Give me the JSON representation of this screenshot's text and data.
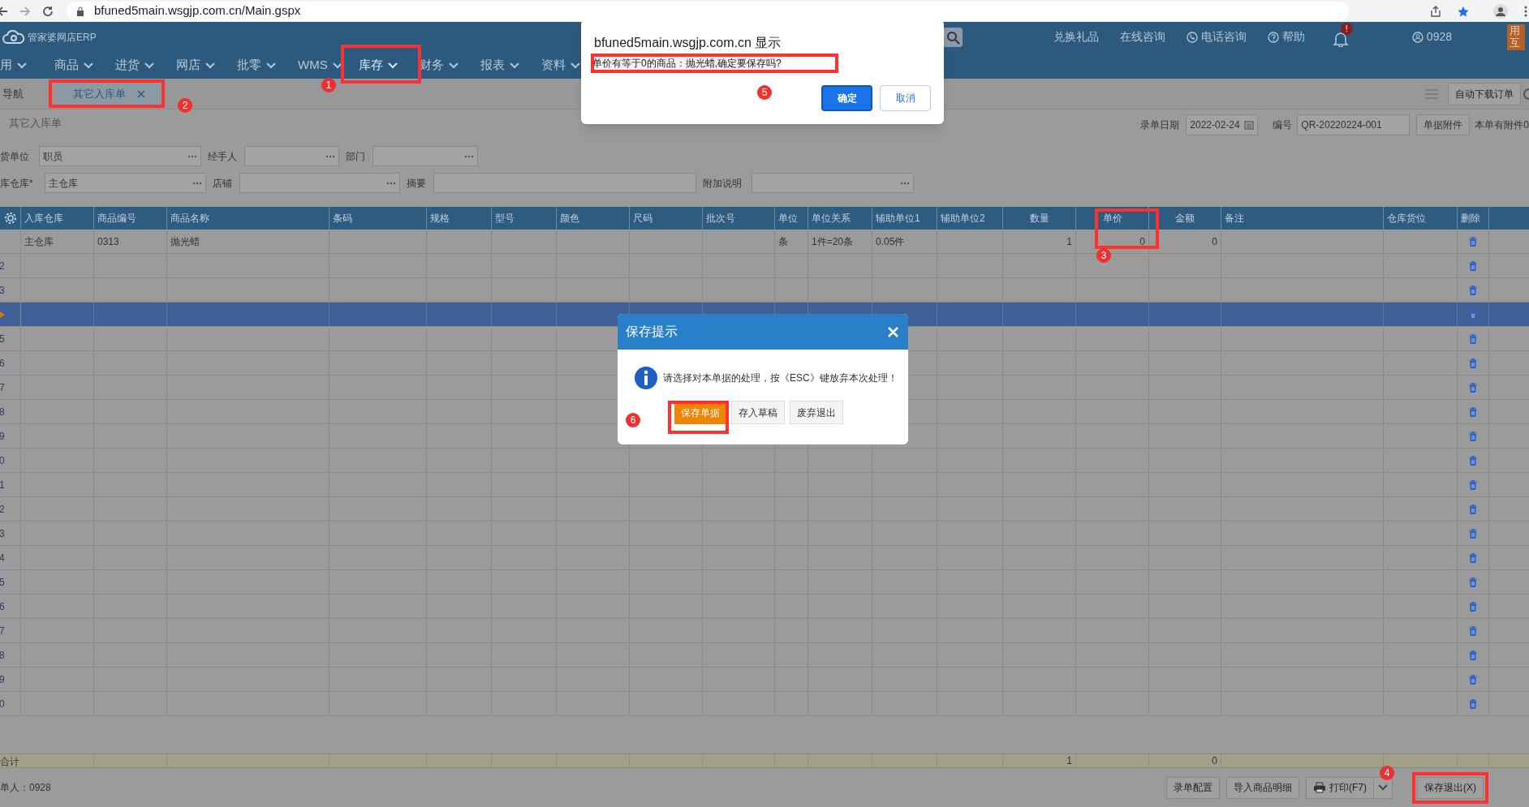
{
  "browser": {
    "url": "bfuned5main.wsgjp.com.cn/Main.gspx"
  },
  "header": {
    "logo": "管家婆网店ERP",
    "links": [
      {
        "kind": "plain",
        "label": "兑换礼品"
      },
      {
        "kind": "plain",
        "label": "在线咨询"
      },
      {
        "kind": "phone",
        "label": "电话咨询"
      },
      {
        "kind": "help",
        "label": "帮助"
      }
    ],
    "bell_badge": "!",
    "user": "0928",
    "promo": [
      "用",
      "互"
    ]
  },
  "menu": [
    {
      "label": "用",
      "selected": false
    },
    {
      "label": "商品",
      "selected": false
    },
    {
      "label": "进货",
      "selected": false
    },
    {
      "label": "网店",
      "selected": false
    },
    {
      "label": "批零",
      "selected": false
    },
    {
      "label": "WMS",
      "selected": false
    },
    {
      "label": "库存",
      "selected": true
    },
    {
      "label": "财务",
      "selected": false
    },
    {
      "label": "报表",
      "selected": false
    },
    {
      "label": "资料",
      "selected": false
    }
  ],
  "tabbar": {
    "nav": "导航",
    "tabs": [
      {
        "label": "其它入库单",
        "selected": true
      }
    ],
    "auto_download": "自动下载订单"
  },
  "form": {
    "title": "其它入库单",
    "date_label": "录单日期",
    "date": "2022-02-24",
    "number_label": "编号",
    "number": "QR-20220224-001",
    "attach_button": "单据附件",
    "attach_note": "本单有附件0",
    "row1": [
      {
        "label": "货单位",
        "value": "职员"
      },
      {
        "label": "经手人"
      },
      {
        "label": "部门"
      }
    ],
    "row2": [
      {
        "label": "库仓库*",
        "value": "主仓库"
      },
      {
        "label": "店铺"
      },
      {
        "label": "摘要",
        "kind": "text"
      },
      {
        "label": "附加说明"
      }
    ]
  },
  "table": {
    "columns": [
      {
        "kind": "text",
        "label": "入库仓库"
      },
      {
        "kind": "text",
        "label": "商品编号"
      },
      {
        "kind": "text",
        "label": "商品名称"
      },
      {
        "kind": "text",
        "label": "条码"
      },
      {
        "kind": "text",
        "label": "规格"
      },
      {
        "kind": "text",
        "label": "型号"
      },
      {
        "kind": "text",
        "label": "颜色"
      },
      {
        "kind": "text",
        "label": "尺码"
      },
      {
        "kind": "text",
        "label": "批次号"
      },
      {
        "kind": "text",
        "label": "单位"
      },
      {
        "kind": "text",
        "label": "单位关系"
      },
      {
        "kind": "text",
        "label": "辅助单位1"
      },
      {
        "kind": "text",
        "label": "辅助单位2"
      },
      {
        "kind": "number",
        "label": "数量"
      },
      {
        "kind": "number",
        "label": "单价"
      },
      {
        "kind": "number",
        "label": "金额"
      },
      {
        "kind": "text",
        "label": "备注"
      },
      {
        "kind": "text",
        "label": "仓库货位"
      },
      {
        "kind": "delete",
        "label": "删除"
      }
    ],
    "rows": [
      {
        "selected": false,
        "cells": [
          "主仓库",
          "0313",
          "抛光蜡",
          null,
          null,
          null,
          null,
          null,
          null,
          "条",
          "1件=20条",
          "0.05件",
          null,
          "1",
          "0",
          "0",
          null,
          null,
          null
        ]
      },
      {
        "label": "2",
        "selected": false
      },
      {
        "label": "3",
        "selected": false
      },
      {
        "selected": true
      },
      {
        "label": "5",
        "selected": false
      },
      {
        "label": "6",
        "selected": false
      },
      {
        "label": "7",
        "selected": false
      },
      {
        "label": "8",
        "selected": false
      },
      {
        "label": "9",
        "selected": false
      },
      {
        "label": "0",
        "selected": false
      },
      {
        "label": "1",
        "selected": false
      },
      {
        "label": "2",
        "selected": false
      },
      {
        "label": "3",
        "selected": false
      },
      {
        "label": "4",
        "selected": false
      },
      {
        "label": "5",
        "selected": false
      },
      {
        "label": "6",
        "selected": false
      },
      {
        "label": "7",
        "selected": false
      },
      {
        "label": "8",
        "selected": false
      },
      {
        "label": "9",
        "selected": false
      },
      {
        "label": "0",
        "selected": false
      }
    ],
    "total": {
      "label": "合计",
      "cells": [
        null,
        null,
        null,
        null,
        null,
        null,
        null,
        null,
        null,
        null,
        null,
        null,
        null,
        "1",
        null,
        "0",
        null,
        null,
        null
      ]
    }
  },
  "footer": {
    "maker": "单人：0928",
    "buttons": [
      {
        "kind": "plain",
        "label": "录单配置"
      },
      {
        "kind": "plain",
        "label": "导入商品明细"
      },
      {
        "kind": "print",
        "label": "打印(F7)"
      },
      {
        "kind": "save",
        "label": "保存退出(X)"
      }
    ]
  },
  "alert": {
    "title": "bfuned5main.wsgjp.com.cn 显示",
    "message": "单价有等于0的商品：抛光蜡,确定要保存吗?",
    "ok": "确定",
    "cancel": "取消"
  },
  "save_dialog": {
    "title": "保存提示",
    "message": "请选择对本单据的处理，按《ESC》键放弃本次处理！",
    "buttons": [
      {
        "label": "保存单据",
        "primary": true
      },
      {
        "label": "存入草稿",
        "primary": false
      },
      {
        "label": "废弃退出",
        "primary": false
      }
    ]
  },
  "annotations": [
    "1",
    "2",
    "3",
    "4",
    "5",
    "6"
  ]
}
